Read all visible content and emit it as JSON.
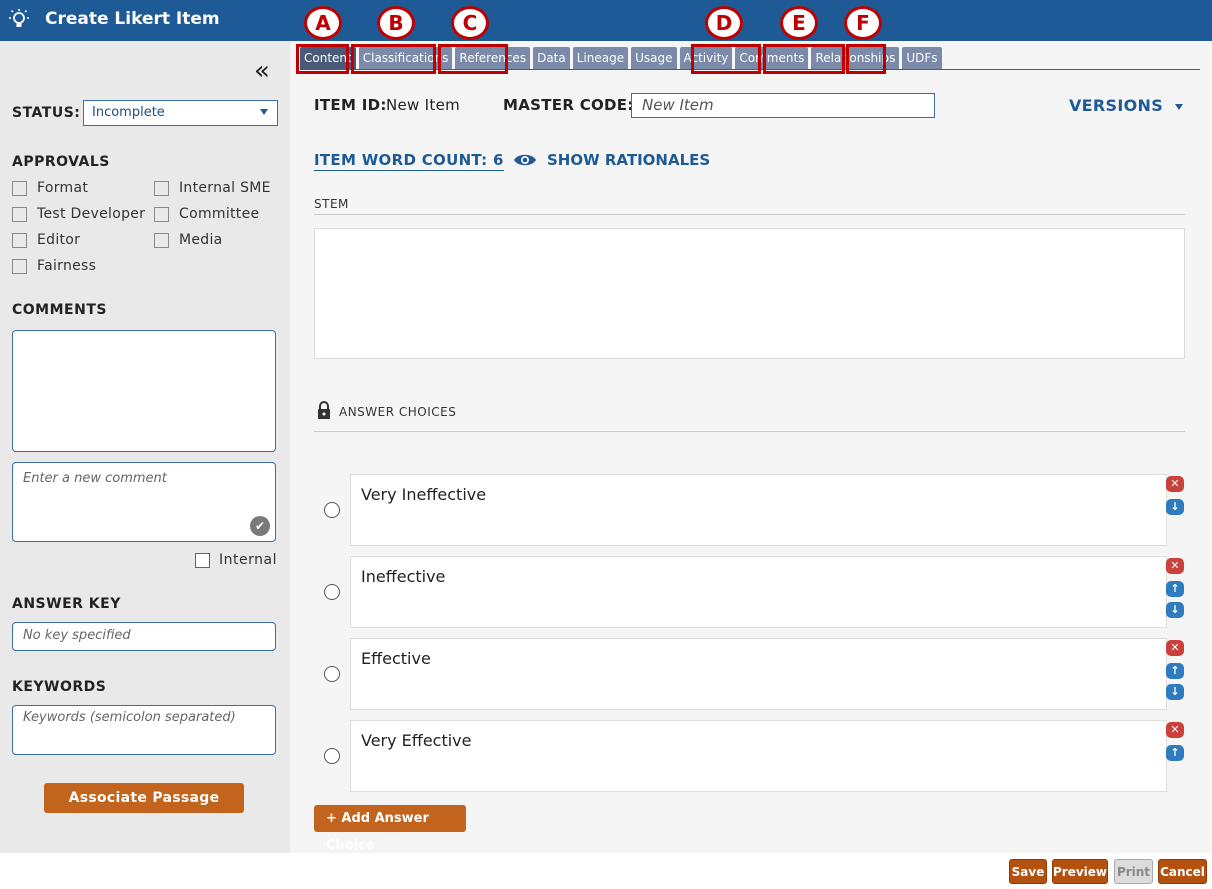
{
  "header": {
    "title": "Create Likert Item",
    "icon": "lightbulb-icon"
  },
  "sidebar": {
    "collapse_glyph": "«",
    "status_label": "STATUS:",
    "status_value": "Incomplete",
    "approvals_label": "APPROVALS",
    "approvals": [
      "Format",
      "Internal SME",
      "Test Developer",
      "Committee",
      "Editor",
      "Media",
      "Fairness"
    ],
    "comments_label": "COMMENTS",
    "new_comment_placeholder": "Enter a new comment",
    "internal_label": "Internal",
    "answer_key_label": "ANSWER KEY",
    "answer_key_placeholder": "No key specified",
    "keywords_label": "KEYWORDS",
    "keywords_placeholder": "Keywords (semicolon separated)",
    "associate_button": "Associate Passage"
  },
  "tabs": [
    "Content",
    "Classifications",
    "References",
    "Data",
    "Lineage",
    "Usage",
    "Activity",
    "Comments",
    "Relationships",
    "UDFs"
  ],
  "annotations": [
    "A",
    "B",
    "C",
    "D",
    "E",
    "F"
  ],
  "item": {
    "id_label": "ITEM ID:",
    "id_value": "New Item",
    "master_code_label": "MASTER CODE:",
    "master_code_placeholder": "New Item",
    "versions_label": "VERSIONS",
    "word_count": "ITEM WORD COUNT: 6",
    "show_rationales": "SHOW RATIONALES",
    "stem_label": "STEM",
    "answer_choices_label": "ANSWER CHOICES"
  },
  "choices": [
    "Very Ineffective",
    "Ineffective",
    "Effective",
    "Very Effective"
  ],
  "add_choice_button": "+ Add Answer Choice",
  "footer": {
    "save": "Save",
    "preview": "Preview",
    "print": "Print",
    "cancel": "Cancel"
  },
  "colors": {
    "header_bg": "#1e5b96",
    "accent": "#c2641e",
    "annotation_red": "#c00000",
    "tab_bg": "#7a8aa8"
  }
}
